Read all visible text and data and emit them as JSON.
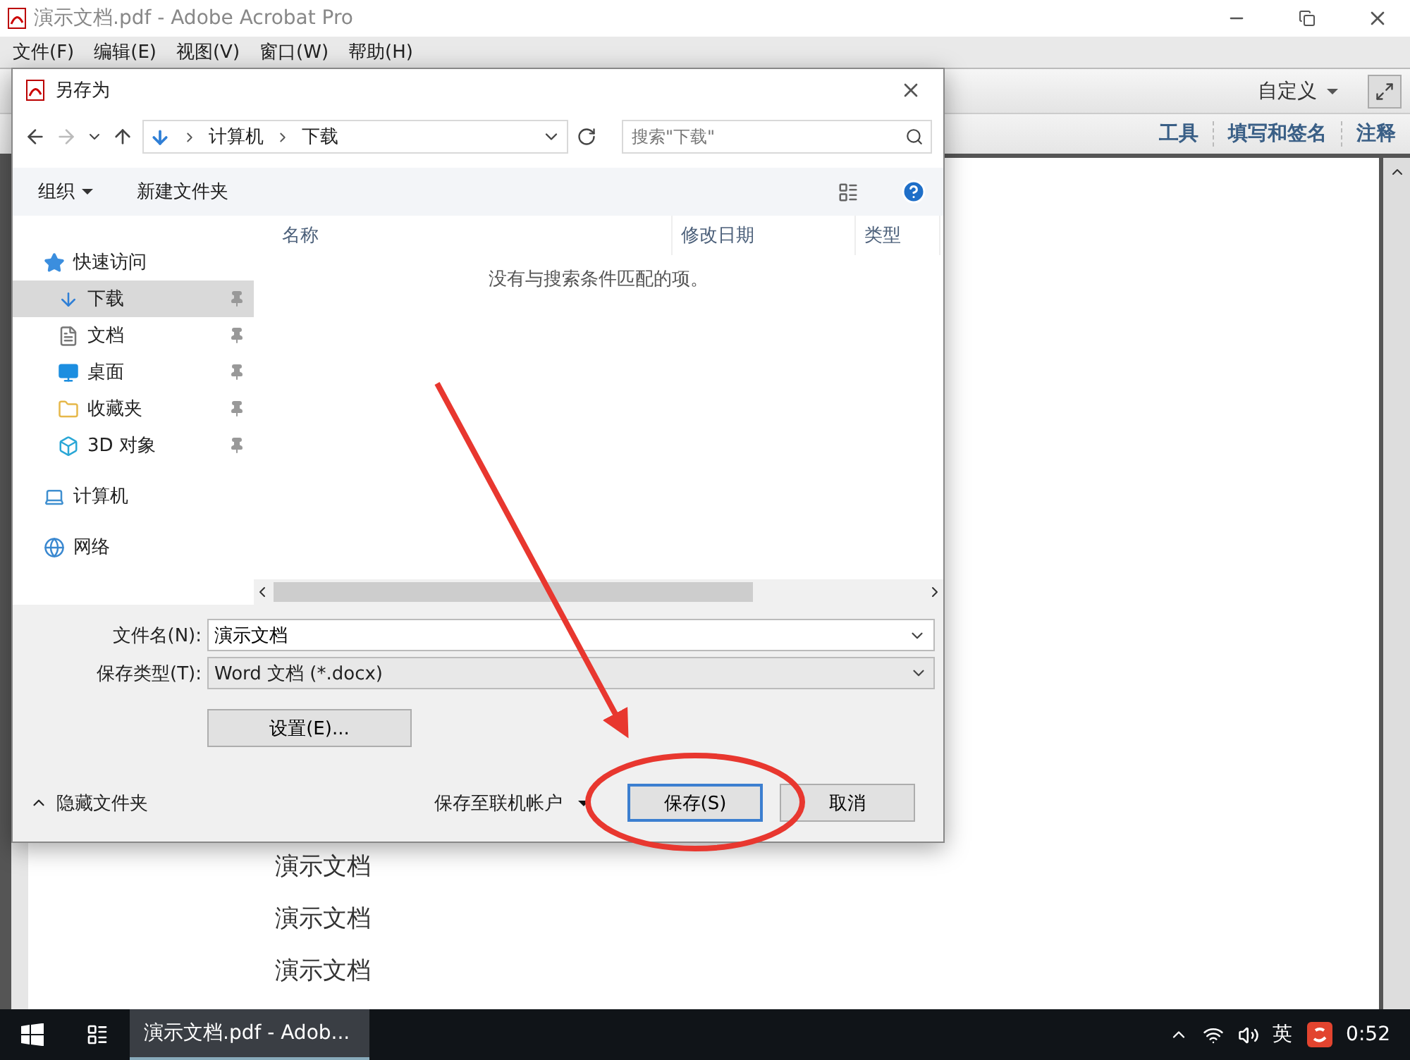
{
  "window": {
    "title": "演示文档.pdf - Adobe Acrobat Pro"
  },
  "menu": [
    {
      "label": "文件(F)"
    },
    {
      "label": "编辑(E)"
    },
    {
      "label": "视图(V)"
    },
    {
      "label": "窗口(W)"
    },
    {
      "label": "帮助(H)"
    }
  ],
  "toolbar": {
    "customize": "自定义"
  },
  "panel_tabs": [
    {
      "label": "工具"
    },
    {
      "label": "填写和签名"
    },
    {
      "label": "注释"
    }
  ],
  "document_lines": [
    "演示文档",
    "演示文档",
    "演示文档"
  ],
  "dialog": {
    "title": "另存为",
    "breadcrumb": [
      "计算机",
      "下载"
    ],
    "search": {
      "placeholder": "搜索\"下载\""
    },
    "commands": {
      "organize": "组织",
      "new_folder": "新建文件夹"
    },
    "nav": [
      {
        "label": "快速访问",
        "kind": "star",
        "selected": false,
        "children": [
          {
            "label": "下载",
            "kind": "download",
            "selected": true,
            "pinned": true
          },
          {
            "label": "文档",
            "kind": "document",
            "selected": false,
            "pinned": true
          },
          {
            "label": "桌面",
            "kind": "desktop",
            "selected": false,
            "pinned": true
          },
          {
            "label": "收藏夹",
            "kind": "favorites",
            "selected": false,
            "pinned": true
          },
          {
            "label": "3D 对象",
            "kind": "cube",
            "selected": false,
            "pinned": true
          }
        ]
      },
      {
        "label": "计算机",
        "kind": "computer",
        "selected": false
      },
      {
        "label": "网络",
        "kind": "network",
        "selected": false
      }
    ],
    "columns": [
      "名称",
      "修改日期",
      "类型"
    ],
    "empty_message": "没有与搜索条件匹配的项。",
    "filename": {
      "label": "文件名(N):",
      "value": "演示文档"
    },
    "filetype": {
      "label": "保存类型(T):",
      "value": "Word 文档 (*.docx)"
    },
    "settings_button": "设置(E)...",
    "hide_folders": "隐藏文件夹",
    "save_online": "保存至联机帐户",
    "buttons": [
      {
        "label": "保存(S)",
        "default": true
      },
      {
        "label": "取消",
        "default": false
      }
    ]
  },
  "taskbar": {
    "app": "演示文档.pdf - Adob...",
    "ime": "英",
    "time": "0:52"
  }
}
